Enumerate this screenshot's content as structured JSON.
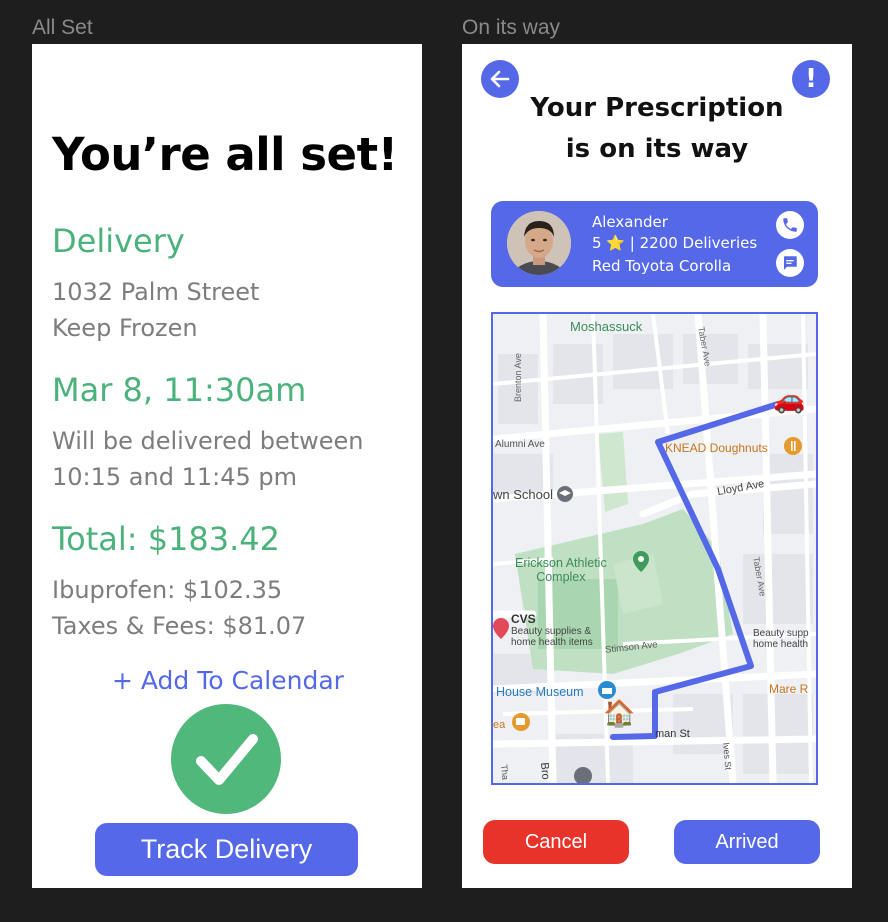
{
  "frames": {
    "left_label": "All Set",
    "right_label": "On its way"
  },
  "all_set": {
    "title": "You’re all set!",
    "delivery_heading": "Delivery",
    "address": "1032 Palm Street",
    "instructions": "Keep Frozen",
    "date_heading": "Mar 8, 11:30am",
    "window_line1": "Will be delivered between",
    "window_line2": "10:15 and 11:45 pm",
    "total_heading": "Total: $183.42",
    "line_item_1": "Ibuprofen: $102.35",
    "line_item_2": "Taxes & Fees: $81.07",
    "add_calendar": "+ Add To Calendar",
    "track_button": "Track Delivery",
    "check_icon": "checkmark-icon"
  },
  "on_its_way": {
    "title_line1": "Your Prescription",
    "title_line2": "is on its way",
    "info_glyph": "!",
    "driver": {
      "name": "Alexander",
      "rating_prefix": "5",
      "rating_star": "⭐",
      "rating_suffix": "| 2200 Deliveries",
      "car": "Red Toyota Corolla"
    },
    "map": {
      "labels": {
        "moshassuck": "Moshassuck",
        "brenton": "Brenton Ave",
        "taber_top": "Taber Ave",
        "alumni": "Alumni Ave",
        "knead": "KNEAD Doughnuts",
        "lloyd": "Lloyd Ave",
        "school": "wn School",
        "erickson_1": "Erickson Athletic",
        "erickson_2": "Complex",
        "taber_mid": "Taber Ave",
        "cvs": "CVS",
        "cvs_sub1": "Beauty supplies &",
        "cvs_sub2": "home health items",
        "beauty_r1": "Beauty supp",
        "beauty_r2": "home health",
        "stimson": "Stimson Ave",
        "house_museum": "House Museum",
        "mare": "Mare R",
        "ea": "ea",
        "man_st": "man St",
        "ives": "Ives St",
        "tha": "Tha",
        "bro": "Bro"
      },
      "car_emoji": "🚗",
      "house_emoji": "🏠",
      "route_color": "#5468e8"
    },
    "cancel_button": "Cancel",
    "arrived_button": "Arrived"
  },
  "colors": {
    "accent": "#5468e8",
    "green": "#4bb27c",
    "cancel": "#e8332a"
  }
}
